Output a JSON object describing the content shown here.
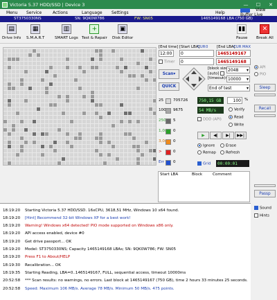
{
  "window": {
    "title": "Victoria 5.37 HDD/SSD | Device 3"
  },
  "menu": {
    "items": [
      "Menu",
      "Service",
      "Actions",
      "Language",
      "Settings",
      "Help"
    ],
    "view_buffer_label": "View Buffer Live"
  },
  "status": {
    "model": "ST3750330NS",
    "serial": "SN: 9QK0W786",
    "firmware": "FW: SN05",
    "capacity": "1465149168 LBA (750 GB)"
  },
  "toolbar": {
    "drive_info": "Drive Info",
    "smart": "S.M.A.R.T",
    "smart_logs": "SMART Logs",
    "test_repair": "Test & Repair",
    "disk_editor": "Disk Editor",
    "pause": "Pause",
    "break_all": "Break All"
  },
  "range": {
    "end_time_label": "End time",
    "start_lba_label": "Start LBA",
    "cur_label": "CUR",
    "zero_label": "0",
    "end_lba_label": "End LBA",
    "max_label": "MAX",
    "end_time_value": "12:00",
    "start_lba_value": "0",
    "end_lba_value": "1465149167",
    "timer_label": "Timer",
    "timer_value": "0",
    "end_lba_value2": "1465149168"
  },
  "scan": {
    "scan_button": "Scan",
    "quick_button": "QUICK",
    "block_size_label": "block size",
    "auto_label": "auto",
    "timeout_label": "timeout(ms)",
    "block_size_value": "2048",
    "timeout_value": "10000",
    "end_of_test": "End of test"
  },
  "legend": {
    "r25_label": "25",
    "r25_value": "705726",
    "r100_label": "100",
    "r100_value": "9675",
    "r250_label": "250",
    "r250_value": "5",
    "r1s_label": "1,0s",
    "r1s_value": "0",
    "r3s_label": "3,0s",
    "r3s_value": "0",
    "rgt_label": ">",
    "rgt_value": "0",
    "err_label": "Err",
    "err_value": "0"
  },
  "progress": {
    "size": "750,15 GB",
    "percent": "100",
    "percent_unit": "%",
    "speed": "54 MB/s",
    "verify": "Verify",
    "read": "Read",
    "write": "Write",
    "ddd_api": "DDD (API)"
  },
  "actions": {
    "ignore": "Ignore",
    "erase": "Erase",
    "remap": "Remap",
    "refresh": "Refresh",
    "grid": "Grid",
    "elapsed": "00:00:01"
  },
  "table": {
    "start_lba": "Start LBA",
    "block": "Block",
    "comment": "Comment"
  },
  "right_panel": {
    "api": "API",
    "pio": "PIO",
    "sleep": "Sleep",
    "recall": "Recall",
    "passp": "Passp"
  },
  "log": [
    {
      "time": "18:19:20",
      "text": "Starting Victoria 5.37 HDD/SSD. 16xCPU, 3618,51 MHz, Windows 10 x64 found.",
      "color": "#000000"
    },
    {
      "time": "18:19:20",
      "text": "[Hint] Recommend 32-bit Windows XP for a best work!",
      "color": "#1a3db0"
    },
    {
      "time": "18:19:20",
      "text": "Warning! Windows x64 detected! PIO mode supported on Windows x86 only.",
      "color": "#c00000"
    },
    {
      "time": "18:19:20",
      "text": "API access enabled, device #0",
      "color": "#000000"
    },
    {
      "time": "18:19:20",
      "text": "Get drive passport... OK",
      "color": "#000000"
    },
    {
      "time": "18:19:20",
      "text": "Model: ST3750330NS; Capacity 1465149168 LBAs; SN: 9QK0W786; FW: SN05",
      "color": "#000000"
    },
    {
      "time": "18:19:20",
      "text": "Press F1 to About/HELP",
      "color": "#c00000"
    },
    {
      "time": "18:19:30",
      "text": "Recalibration... OK",
      "color": "#000000"
    },
    {
      "time": "18:19:35",
      "text": "Starting Reading, LBA=0..1465149167, FULL, sequential access, timeout 10000ms",
      "color": "#000000"
    },
    {
      "time": "20:52:58",
      "text": "*** Scan results: no warnings, no errors. Last block at 1465149167 (750 GB), time 2 hours 33 minutes 25 seconds.",
      "color": "#000000"
    },
    {
      "time": "20:52:58",
      "text": "Speed: Maximum 106 MB/s. Average 78 MB/s. Minimum 50 MB/s. 475 points.",
      "color": "#1a3db0"
    }
  ],
  "log_options": {
    "sound": "Sound",
    "hints": "Hints"
  }
}
